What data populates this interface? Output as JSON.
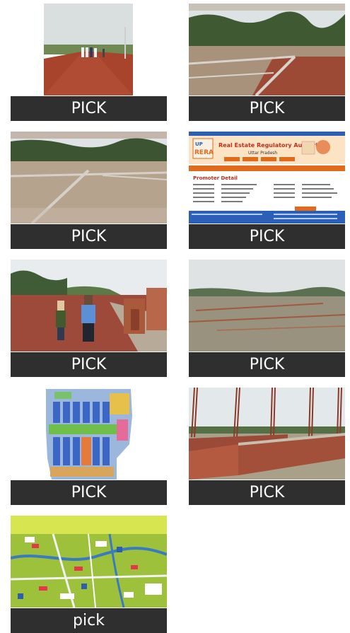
{
  "tiles": [
    {
      "label": "PICK"
    },
    {
      "label": "PICK"
    },
    {
      "label": "PICK"
    },
    {
      "label": "PICK"
    },
    {
      "label": "PICK"
    },
    {
      "label": "PICK"
    },
    {
      "label": "PICK"
    },
    {
      "label": "PICK"
    },
    {
      "label": "pick"
    }
  ],
  "rera_card": {
    "logo_top": "UP",
    "logo_main": "RERA",
    "heading_line1": "Real Estate Regulatory Authority",
    "heading_line2": "Uttar Pradesh",
    "section_title": "Promoter Detail"
  },
  "colors": {
    "label_bar": "#2f2f2f",
    "label_text": "#ffffff",
    "soil_red": "#a8442c",
    "map_green": "#b9d234"
  }
}
